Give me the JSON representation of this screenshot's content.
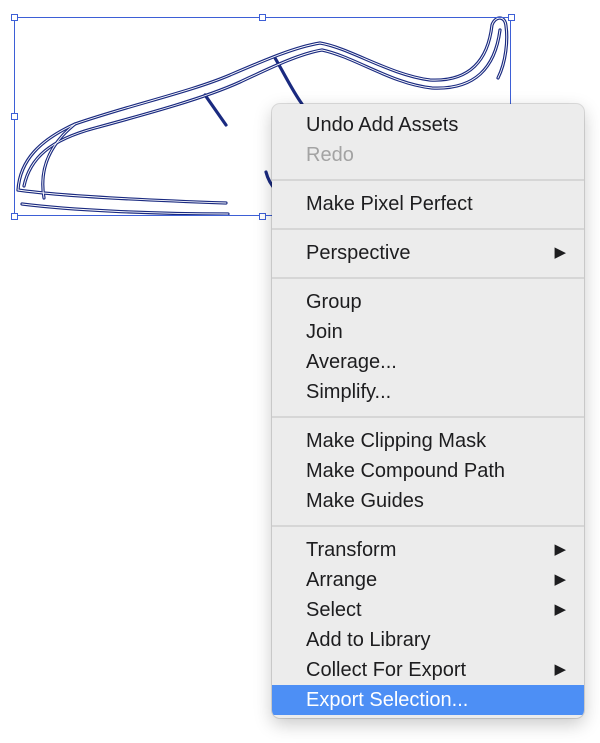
{
  "colors": {
    "selection": "#3d5fd6",
    "stroke_outer": "#1a2a80",
    "menu_bg": "#ececec",
    "highlight": "#4d8ff5",
    "disabled_text": "#a3a3a3"
  },
  "artwork": {
    "name": "shoe-outline"
  },
  "menu": {
    "groups": [
      [
        {
          "label": "Undo Add Assets",
          "enabled": true
        },
        {
          "label": "Redo",
          "enabled": false
        }
      ],
      [
        {
          "label": "Make Pixel Perfect",
          "enabled": true
        }
      ],
      [
        {
          "label": "Perspective",
          "enabled": true,
          "submenu": true,
          "arrow": "▶"
        }
      ],
      [
        {
          "label": "Group",
          "enabled": true
        },
        {
          "label": "Join",
          "enabled": true
        },
        {
          "label": "Average...",
          "enabled": true
        },
        {
          "label": "Simplify...",
          "enabled": true
        }
      ],
      [
        {
          "label": "Make Clipping Mask",
          "enabled": true
        },
        {
          "label": "Make Compound Path",
          "enabled": true
        },
        {
          "label": "Make Guides",
          "enabled": true
        }
      ],
      [
        {
          "label": "Transform",
          "enabled": true,
          "submenu": true,
          "arrow": "▶"
        },
        {
          "label": "Arrange",
          "enabled": true,
          "submenu": true,
          "arrow": "▶"
        },
        {
          "label": "Select",
          "enabled": true,
          "submenu": true,
          "arrow": "▶"
        },
        {
          "label": "Add to Library",
          "enabled": true
        },
        {
          "label": "Collect For Export",
          "enabled": true,
          "submenu": true,
          "arrow": "▶"
        },
        {
          "label": "Export Selection...",
          "enabled": true,
          "highlighted": true
        }
      ]
    ]
  }
}
